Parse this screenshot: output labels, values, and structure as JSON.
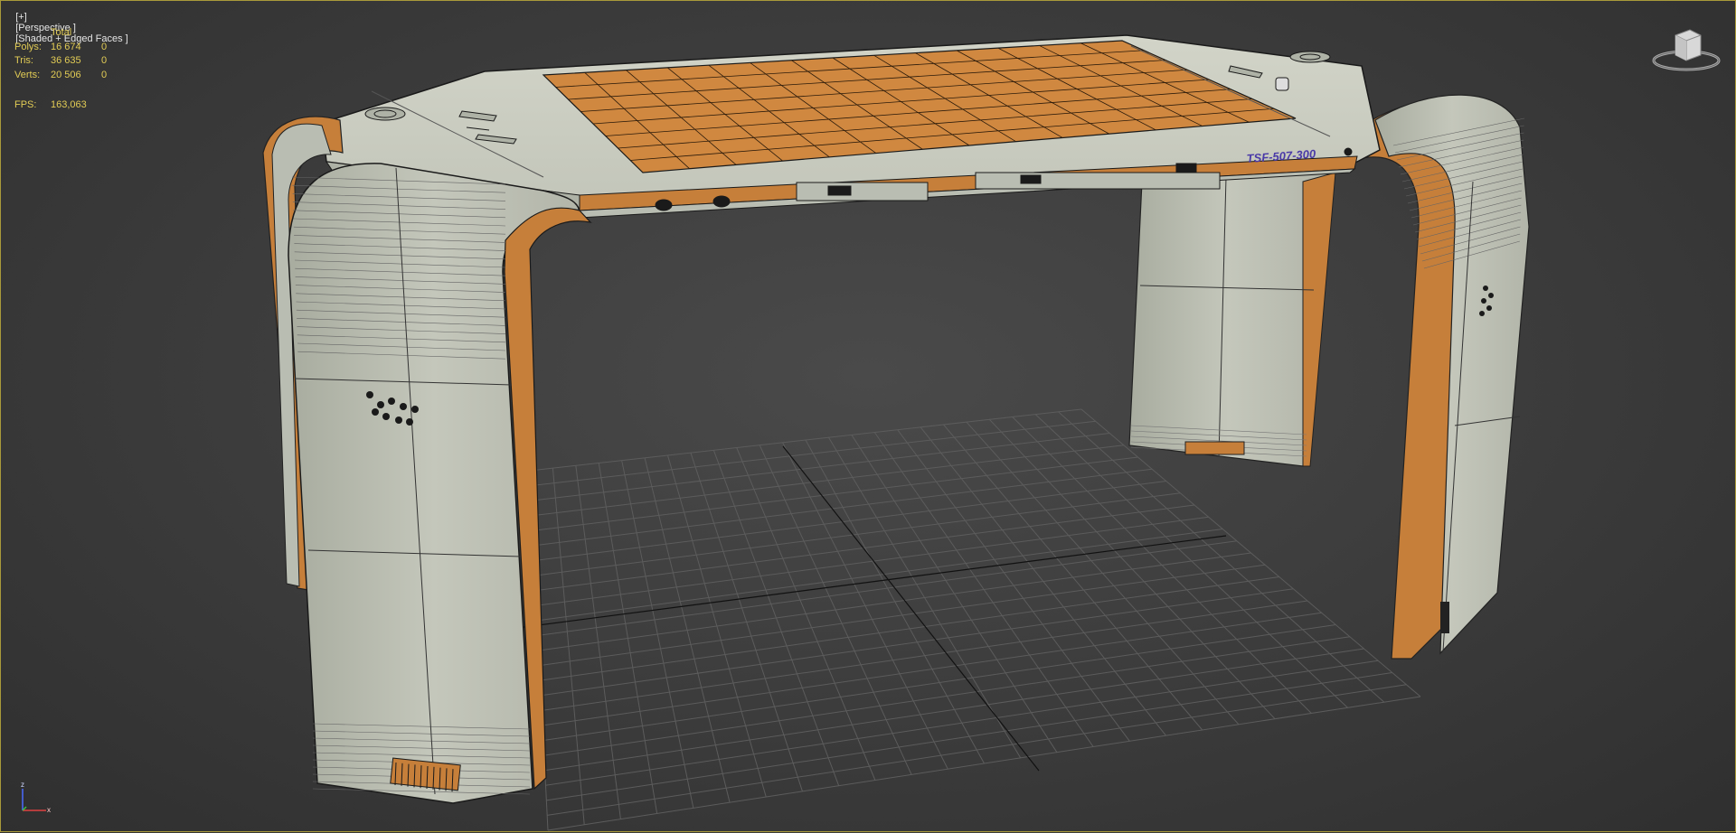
{
  "viewport": {
    "label": "[+] [Perspective ] [Shaded + Edged Faces ]",
    "label_parts": [
      "[+]",
      "[Perspective ]",
      "[Shaded + Edged Faces ]"
    ],
    "border_color": "#a99a3a"
  },
  "stats": {
    "header": "Total",
    "rows": [
      {
        "label": "Polys:",
        "total": "16 674",
        "selected": "0"
      },
      {
        "label": "Tris:",
        "total": "36 635",
        "selected": "0"
      },
      {
        "label": "Verts:",
        "total": "20 506",
        "selected": "0"
      }
    ],
    "fps_label": "FPS:",
    "fps_value": "163,063",
    "text_color": "#e2cc55"
  },
  "model": {
    "brand_text": "TSF-507-300",
    "brand_color": "#4a3aa8",
    "surface_color": "#b9bdb2",
    "accent_color": "#c67f3a",
    "edge_color": "#1a1a1a"
  },
  "icons": {
    "viewcube": "viewcube-icon",
    "axis": "axis-tripod-icon"
  },
  "axis": {
    "x_label": "x",
    "z_label": "z"
  }
}
